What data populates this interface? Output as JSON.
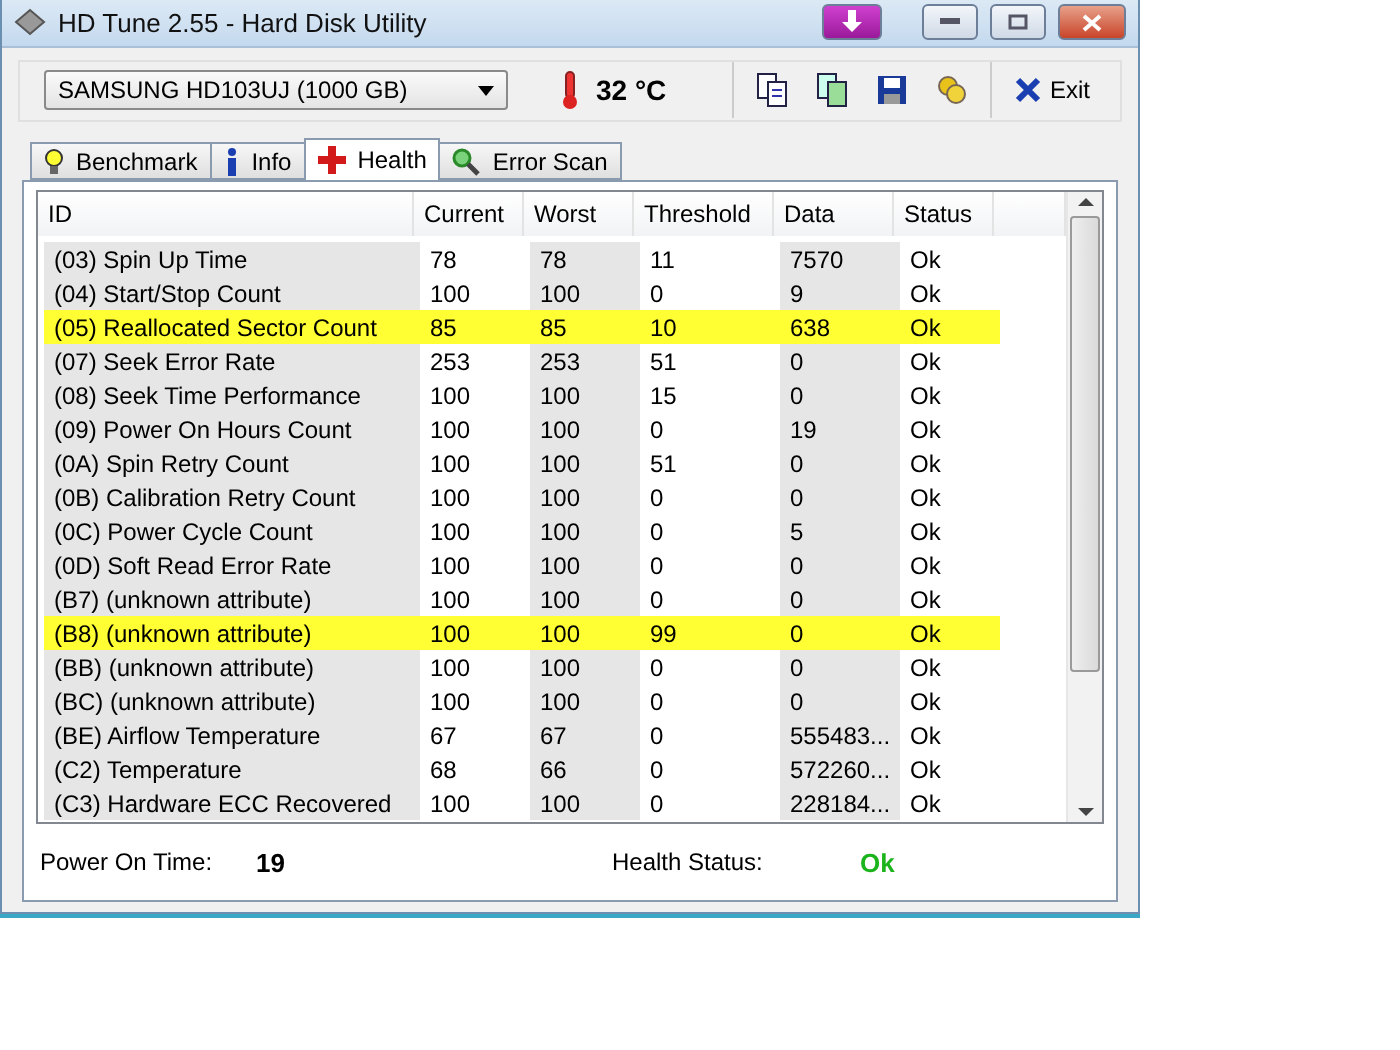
{
  "window": {
    "title": "HD Tune 2.55 - Hard Disk Utility"
  },
  "drive_select": {
    "value": "SAMSUNG HD103UJ (1000 GB)"
  },
  "temperature": "32 °C",
  "exit_button": "Exit",
  "tabs": [
    {
      "label": "Benchmark",
      "selected": false,
      "kind": "benchmark"
    },
    {
      "label": "Info",
      "selected": false,
      "kind": "info"
    },
    {
      "label": "Health",
      "selected": true,
      "kind": "health"
    },
    {
      "label": "Error Scan",
      "selected": false,
      "kind": "scan"
    }
  ],
  "table": {
    "columns": [
      "ID",
      "Current",
      "Worst",
      "Threshold",
      "Data",
      "Status"
    ],
    "rows": [
      {
        "cells": [
          "(03) Spin Up Time",
          "78",
          "78",
          "11",
          "7570",
          "Ok"
        ],
        "highlighted": false
      },
      {
        "cells": [
          "(04) Start/Stop Count",
          "100",
          "100",
          "0",
          "9",
          "Ok"
        ],
        "highlighted": false
      },
      {
        "cells": [
          "(05) Reallocated Sector Count",
          "85",
          "85",
          "10",
          "638",
          "Ok"
        ],
        "highlighted": true
      },
      {
        "cells": [
          "(07) Seek Error Rate",
          "253",
          "253",
          "51",
          "0",
          "Ok"
        ],
        "highlighted": false
      },
      {
        "cells": [
          "(08) Seek Time Performance",
          "100",
          "100",
          "15",
          "0",
          "Ok"
        ],
        "highlighted": false
      },
      {
        "cells": [
          "(09) Power On Hours Count",
          "100",
          "100",
          "0",
          "19",
          "Ok"
        ],
        "highlighted": false
      },
      {
        "cells": [
          "(0A) Spin Retry Count",
          "100",
          "100",
          "51",
          "0",
          "Ok"
        ],
        "highlighted": false
      },
      {
        "cells": [
          "(0B) Calibration Retry Count",
          "100",
          "100",
          "0",
          "0",
          "Ok"
        ],
        "highlighted": false
      },
      {
        "cells": [
          "(0C) Power Cycle Count",
          "100",
          "100",
          "0",
          "5",
          "Ok"
        ],
        "highlighted": false
      },
      {
        "cells": [
          "(0D) Soft Read Error Rate",
          "100",
          "100",
          "0",
          "0",
          "Ok"
        ],
        "highlighted": false
      },
      {
        "cells": [
          "(B7) (unknown attribute)",
          "100",
          "100",
          "0",
          "0",
          "Ok"
        ],
        "highlighted": false
      },
      {
        "cells": [
          "(B8) (unknown attribute)",
          "100",
          "100",
          "99",
          "0",
          "Ok"
        ],
        "highlighted": true
      },
      {
        "cells": [
          "(BB) (unknown attribute)",
          "100",
          "100",
          "0",
          "0",
          "Ok"
        ],
        "highlighted": false
      },
      {
        "cells": [
          "(BC) (unknown attribute)",
          "100",
          "100",
          "0",
          "0",
          "Ok"
        ],
        "highlighted": false
      },
      {
        "cells": [
          "(BE) Airflow Temperature",
          "67",
          "67",
          "0",
          "555483...",
          "Ok"
        ],
        "highlighted": false
      },
      {
        "cells": [
          "(C2) Temperature",
          "68",
          "66",
          "0",
          "572260...",
          "Ok"
        ],
        "highlighted": false
      },
      {
        "cells": [
          "(C3) Hardware ECC Recovered",
          "100",
          "100",
          "0",
          "228184...",
          "Ok"
        ],
        "highlighted": false
      }
    ]
  },
  "status": {
    "power_on_label": "Power On Time:",
    "power_on_value": "19",
    "health_label": "Health Status:",
    "health_value": "Ok"
  }
}
